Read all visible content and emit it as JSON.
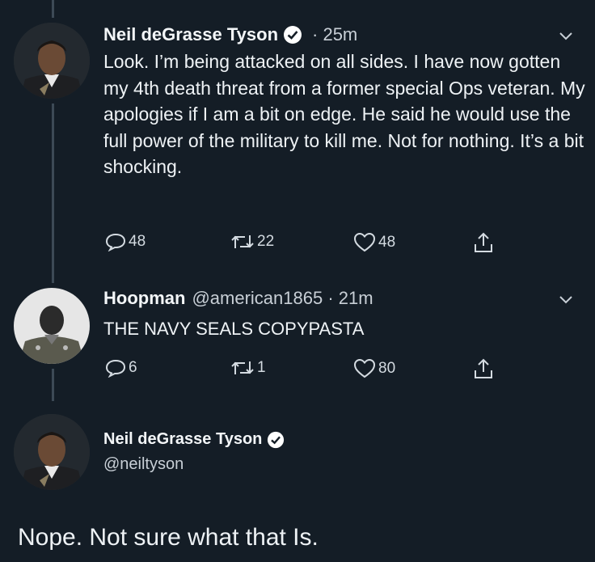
{
  "tweet1": {
    "name": "Neil deGrasse Tyson",
    "time": "· 25m",
    "text": "Look. I’m being attacked on all sides. I have now gotten my 4th death threat from a former special Ops veteran. My apologies if I am a bit on edge. He said he would use the full power of the military to kill me. Not for nothing. It’s a bit shocking.",
    "replies": "48",
    "retweets": "22",
    "likes": "48"
  },
  "tweet2": {
    "name": "Hoopman",
    "handle_time": "@american1865 · 21m",
    "text": "THE NAVY SEALS COPYPASTA",
    "replies": "6",
    "retweets": "1",
    "likes": "80"
  },
  "tweet3": {
    "name": "Neil deGrasse Tyson",
    "handle": "@neiltyson",
    "text": "Nope. Not sure what that Is."
  },
  "colors": {
    "background": "#141d26",
    "verified": "#ffffff",
    "thread_line": "#3d4a56"
  }
}
